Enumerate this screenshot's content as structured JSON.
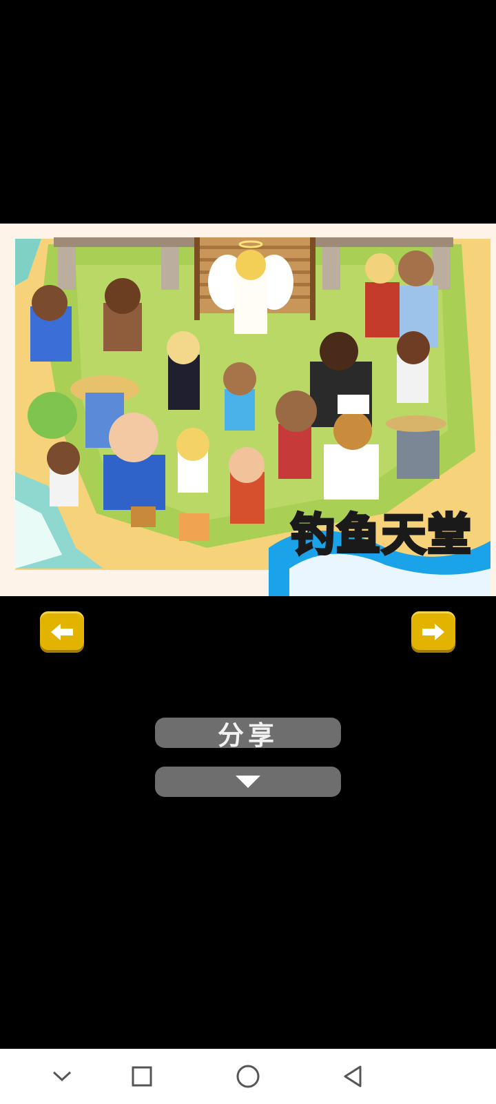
{
  "app": {
    "banner_title": "钓鱼天堂",
    "banner_title_color": "#f39a00"
  },
  "navigation": {
    "prev_icon": "arrow-left-icon",
    "next_icon": "arrow-right-icon",
    "arrow_color": "#e2b400"
  },
  "actions": {
    "share_label": "分享",
    "expand_icon": "triangle-down-icon",
    "button_color": "#6e6e6e"
  },
  "system_nav": {
    "items": [
      {
        "icon": "chevron-down-icon"
      },
      {
        "icon": "square-recents-icon"
      },
      {
        "icon": "circle-home-icon"
      },
      {
        "icon": "triangle-back-icon"
      }
    ]
  }
}
